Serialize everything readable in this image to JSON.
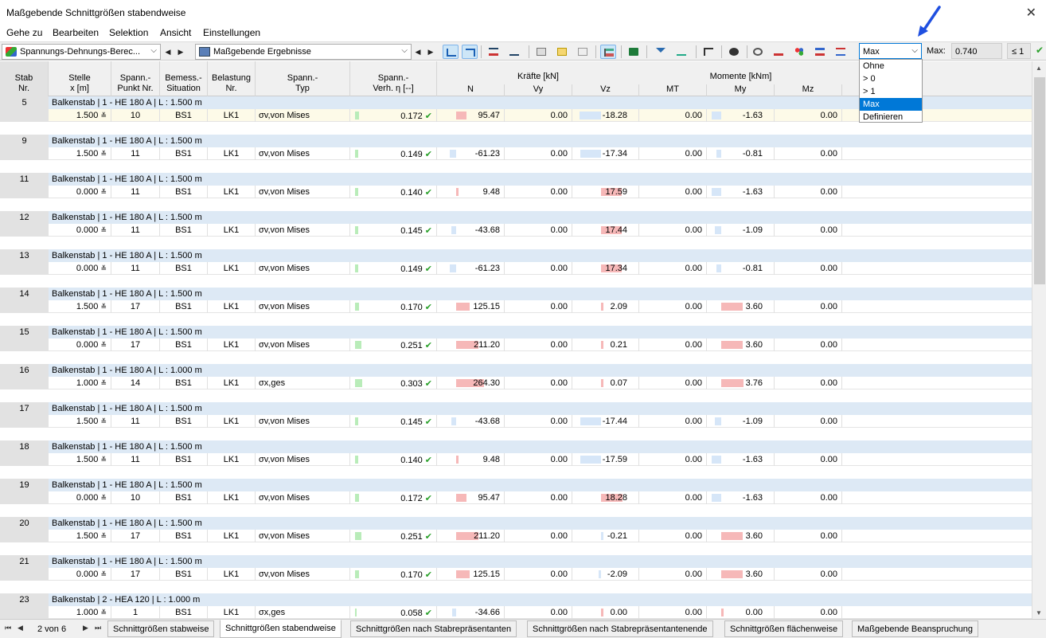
{
  "window": {
    "title": "Maßgebende Schnittgrößen stabendweise",
    "close": "✕"
  },
  "menu": [
    "Gehe zu",
    "Bearbeiten",
    "Selektion",
    "Ansicht",
    "Einstellungen"
  ],
  "toolbar": {
    "combo1": "Spannungs-Dehnungs-Berec...",
    "combo2": "Maßgebende Ergebnisse",
    "filter_value": "Max",
    "max_label": "Max:",
    "max_value": "0.740",
    "le_value": "≤ 1"
  },
  "dropdown": {
    "options": [
      "Ohne",
      "> 0",
      "> 1",
      "Max",
      "Definieren"
    ],
    "selected": "Max"
  },
  "header": {
    "stab": [
      "Stab",
      "Nr."
    ],
    "stelle": [
      "Stelle",
      "x [m]"
    ],
    "spannpunkt": [
      "Spann.-",
      "Punkt Nr."
    ],
    "bemess": [
      "Bemess.-",
      "Situation"
    ],
    "belastung": [
      "Belastung",
      "Nr."
    ],
    "spanntyp": [
      "Spann.-",
      "Typ"
    ],
    "verh": [
      "Spann.-",
      "Verh. η [--]"
    ],
    "kraefte": "Kräfte [kN]",
    "momente": "Momente [kNm]",
    "n": "N",
    "vy": "Vy",
    "vz": "Vz",
    "mt": "MT",
    "my": "My",
    "mz": "Mz"
  },
  "rows": [
    {
      "nr": "5",
      "desc": "Balkenstab | 1 - HE 180 A | L : 1.500 m",
      "x": "1.500",
      "pt": "10",
      "bs": "BS1",
      "lk": "LK1",
      "typ": "σv,von Mises",
      "eta": "0.172",
      "eta_frac": 0.172,
      "n": "95.47",
      "n_val": 95.47,
      "vy": "0.00",
      "vz": "-18.28",
      "vz_val": -18.28,
      "mt": "0.00",
      "my": "-1.63",
      "my_val": -1.63,
      "mz": "0.00"
    },
    {
      "nr": "9",
      "desc": "Balkenstab | 1 - HE 180 A | L : 1.500 m",
      "x": "1.500",
      "pt": "11",
      "bs": "BS1",
      "lk": "LK1",
      "typ": "σv,von Mises",
      "eta": "0.149",
      "eta_frac": 0.149,
      "n": "-61.23",
      "n_val": -61.23,
      "vy": "0.00",
      "vz": "-17.34",
      "vz_val": -17.34,
      "mt": "0.00",
      "my": "-0.81",
      "my_val": -0.81,
      "mz": "0.00"
    },
    {
      "nr": "11",
      "desc": "Balkenstab | 1 - HE 180 A | L : 1.500 m",
      "x": "0.000",
      "pt": "11",
      "bs": "BS1",
      "lk": "LK1",
      "typ": "σv,von Mises",
      "eta": "0.140",
      "eta_frac": 0.14,
      "n": "9.48",
      "n_val": 9.48,
      "vy": "0.00",
      "vz": "17.59",
      "vz_val": 17.59,
      "mt": "0.00",
      "my": "-1.63",
      "my_val": -1.63,
      "mz": "0.00"
    },
    {
      "nr": "12",
      "desc": "Balkenstab | 1 - HE 180 A | L : 1.500 m",
      "x": "0.000",
      "pt": "11",
      "bs": "BS1",
      "lk": "LK1",
      "typ": "σv,von Mises",
      "eta": "0.145",
      "eta_frac": 0.145,
      "n": "-43.68",
      "n_val": -43.68,
      "vy": "0.00",
      "vz": "17.44",
      "vz_val": 17.44,
      "mt": "0.00",
      "my": "-1.09",
      "my_val": -1.09,
      "mz": "0.00"
    },
    {
      "nr": "13",
      "desc": "Balkenstab | 1 - HE 180 A | L : 1.500 m",
      "x": "0.000",
      "pt": "11",
      "bs": "BS1",
      "lk": "LK1",
      "typ": "σv,von Mises",
      "eta": "0.149",
      "eta_frac": 0.149,
      "n": "-61.23",
      "n_val": -61.23,
      "vy": "0.00",
      "vz": "17.34",
      "vz_val": 17.34,
      "mt": "0.00",
      "my": "-0.81",
      "my_val": -0.81,
      "mz": "0.00"
    },
    {
      "nr": "14",
      "desc": "Balkenstab | 1 - HE 180 A | L : 1.500 m",
      "x": "1.500",
      "pt": "17",
      "bs": "BS1",
      "lk": "LK1",
      "typ": "σv,von Mises",
      "eta": "0.170",
      "eta_frac": 0.17,
      "n": "125.15",
      "n_val": 125.15,
      "vy": "0.00",
      "vz": "2.09",
      "vz_val": 2.09,
      "mt": "0.00",
      "my": "3.60",
      "my_val": 3.6,
      "mz": "0.00"
    },
    {
      "nr": "15",
      "desc": "Balkenstab | 1 - HE 180 A | L : 1.500 m",
      "x": "0.000",
      "pt": "17",
      "bs": "BS1",
      "lk": "LK1",
      "typ": "σv,von Mises",
      "eta": "0.251",
      "eta_frac": 0.251,
      "n": "211.20",
      "n_val": 211.2,
      "vy": "0.00",
      "vz": "0.21",
      "vz_val": 0.21,
      "mt": "0.00",
      "my": "3.60",
      "my_val": 3.6,
      "mz": "0.00"
    },
    {
      "nr": "16",
      "desc": "Balkenstab | 1 - HE 180 A | L : 1.000 m",
      "x": "1.000",
      "pt": "14",
      "bs": "BS1",
      "lk": "LK1",
      "typ": "σx,ges",
      "eta": "0.303",
      "eta_frac": 0.303,
      "n": "264.30",
      "n_val": 264.3,
      "vy": "0.00",
      "vz": "0.07",
      "vz_val": 0.07,
      "mt": "0.00",
      "my": "3.76",
      "my_val": 3.76,
      "mz": "0.00"
    },
    {
      "nr": "17",
      "desc": "Balkenstab | 1 - HE 180 A | L : 1.500 m",
      "x": "1.500",
      "pt": "11",
      "bs": "BS1",
      "lk": "LK1",
      "typ": "σv,von Mises",
      "eta": "0.145",
      "eta_frac": 0.145,
      "n": "-43.68",
      "n_val": -43.68,
      "vy": "0.00",
      "vz": "-17.44",
      "vz_val": -17.44,
      "mt": "0.00",
      "my": "-1.09",
      "my_val": -1.09,
      "mz": "0.00"
    },
    {
      "nr": "18",
      "desc": "Balkenstab | 1 - HE 180 A | L : 1.500 m",
      "x": "1.500",
      "pt": "11",
      "bs": "BS1",
      "lk": "LK1",
      "typ": "σv,von Mises",
      "eta": "0.140",
      "eta_frac": 0.14,
      "n": "9.48",
      "n_val": 9.48,
      "vy": "0.00",
      "vz": "-17.59",
      "vz_val": -17.59,
      "mt": "0.00",
      "my": "-1.63",
      "my_val": -1.63,
      "mz": "0.00"
    },
    {
      "nr": "19",
      "desc": "Balkenstab | 1 - HE 180 A | L : 1.500 m",
      "x": "0.000",
      "pt": "10",
      "bs": "BS1",
      "lk": "LK1",
      "typ": "σv,von Mises",
      "eta": "0.172",
      "eta_frac": 0.172,
      "n": "95.47",
      "n_val": 95.47,
      "vy": "0.00",
      "vz": "18.28",
      "vz_val": 18.28,
      "mt": "0.00",
      "my": "-1.63",
      "my_val": -1.63,
      "mz": "0.00"
    },
    {
      "nr": "20",
      "desc": "Balkenstab | 1 - HE 180 A | L : 1.500 m",
      "x": "1.500",
      "pt": "17",
      "bs": "BS1",
      "lk": "LK1",
      "typ": "σv,von Mises",
      "eta": "0.251",
      "eta_frac": 0.251,
      "n": "211.20",
      "n_val": 211.2,
      "vy": "0.00",
      "vz": "-0.21",
      "vz_val": -0.21,
      "mt": "0.00",
      "my": "3.60",
      "my_val": 3.6,
      "mz": "0.00"
    },
    {
      "nr": "21",
      "desc": "Balkenstab | 1 - HE 180 A | L : 1.500 m",
      "x": "0.000",
      "pt": "17",
      "bs": "BS1",
      "lk": "LK1",
      "typ": "σv,von Mises",
      "eta": "0.170",
      "eta_frac": 0.17,
      "n": "125.15",
      "n_val": 125.15,
      "vy": "0.00",
      "vz": "-2.09",
      "vz_val": -2.09,
      "mt": "0.00",
      "my": "3.60",
      "my_val": 3.6,
      "mz": "0.00"
    },
    {
      "nr": "23",
      "desc": "Balkenstab | 2 - HEA 120 | L : 1.000 m",
      "x": "1.000",
      "pt": "1",
      "bs": "BS1",
      "lk": "LK1",
      "typ": "σx,ges",
      "eta": "0.058",
      "eta_frac": 0.058,
      "n": "-34.66",
      "n_val": -34.66,
      "vy": "0.00",
      "vz": "0.00",
      "vz_val": 0,
      "mt": "0.00",
      "my": "0.00",
      "my_val": 0,
      "mz": "0.00"
    }
  ],
  "footer": {
    "page": "2 von 6",
    "tabs": [
      "Schnittgrößen stabweise",
      "Schnittgrößen stabendweise",
      "Schnittgrößen nach Stabrepräsentanten",
      "Schnittgrößen nach Stabrepräsentantenende",
      "Schnittgrößen flächenweise",
      "Maßgebende Beanspruchung"
    ],
    "active_tab": 1
  },
  "colors": {
    "positive_bar": "#f6b8b8",
    "negative_bar": "#d6e6f8",
    "ratio_bar": "#b9ecb9",
    "ok_check": "#2aa02a",
    "selection": "#0078d7"
  }
}
